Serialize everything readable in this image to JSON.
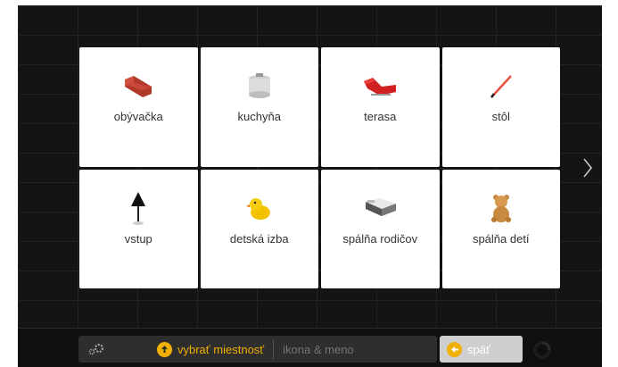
{
  "rooms": [
    {
      "label": "obývačka",
      "icon": "sofa-icon"
    },
    {
      "label": "kuchyňa",
      "icon": "pot-icon"
    },
    {
      "label": "terasa",
      "icon": "lounger-icon"
    },
    {
      "label": "stôl",
      "icon": "pencil-icon"
    },
    {
      "label": "vstup",
      "icon": "umbrella-icon"
    },
    {
      "label": "detská izba",
      "icon": "duck-icon"
    },
    {
      "label": "spálňa rodičov",
      "icon": "bed-icon"
    },
    {
      "label": "spálňa detí",
      "icon": "teddy-bear-icon"
    }
  ],
  "bottom_bar": {
    "select_room_label": "vybrať miestnosť",
    "name_placeholder": "ikona & meno",
    "back_label": "späť"
  },
  "colors": {
    "accent": "#f0b000",
    "background": "#141414",
    "tile": "#ffffff"
  }
}
